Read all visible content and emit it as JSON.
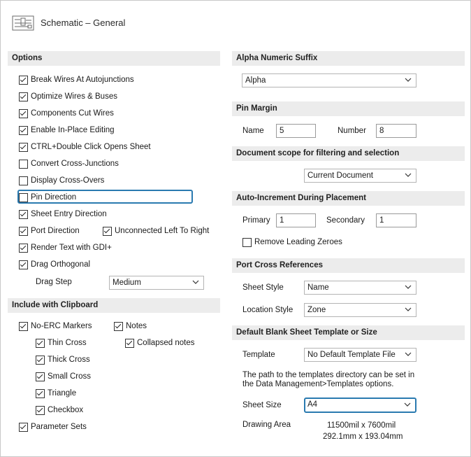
{
  "header": {
    "title": "Schematic – General",
    "icon": "schematic-document-icon"
  },
  "options": {
    "title": "Options",
    "items": [
      {
        "label": "Break Wires At Autojunctions",
        "checked": true
      },
      {
        "label": "Optimize Wires & Buses",
        "checked": true
      },
      {
        "label": "Components Cut Wires",
        "checked": true
      },
      {
        "label": "Enable In-Place Editing",
        "checked": true
      },
      {
        "label": "CTRL+Double Click Opens Sheet",
        "checked": true
      },
      {
        "label": "Convert Cross-Junctions",
        "checked": false
      },
      {
        "label": "Display Cross-Overs",
        "checked": false
      },
      {
        "label": "Pin Direction",
        "checked": false
      },
      {
        "label": "Sheet Entry Direction",
        "checked": true
      },
      {
        "label": "Port Direction",
        "checked": true
      },
      {
        "label": "Unconnected Left To Right",
        "checked": true
      },
      {
        "label": "Render Text with GDI+",
        "checked": true
      },
      {
        "label": "Drag Orthogonal",
        "checked": true
      }
    ],
    "drag_step_label": "Drag Step",
    "drag_step_value": "Medium"
  },
  "clipboard": {
    "title": "Include with Clipboard",
    "no_erc": {
      "label": "No-ERC Markers",
      "checked": true
    },
    "notes": {
      "label": "Notes",
      "checked": true
    },
    "thin_cross": {
      "label": "Thin Cross",
      "checked": true
    },
    "collapsed_notes": {
      "label": "Collapsed notes",
      "checked": true
    },
    "thick_cross": {
      "label": "Thick Cross",
      "checked": true
    },
    "small_cross": {
      "label": "Small Cross",
      "checked": true
    },
    "triangle": {
      "label": "Triangle",
      "checked": true
    },
    "checkbox": {
      "label": "Checkbox",
      "checked": true
    },
    "parameter_sets": {
      "label": "Parameter Sets",
      "checked": true
    }
  },
  "alpha_suffix": {
    "title": "Alpha Numeric Suffix",
    "value": "Alpha"
  },
  "pin_margin": {
    "title": "Pin Margin",
    "name_label": "Name",
    "name_value": "5",
    "number_label": "Number",
    "number_value": "8"
  },
  "doc_scope": {
    "title": "Document scope for filtering and selection",
    "value": "Current Document"
  },
  "auto_increment": {
    "title": "Auto-Increment During Placement",
    "primary_label": "Primary",
    "primary_value": "1",
    "secondary_label": "Secondary",
    "secondary_value": "1",
    "remove_zeroes": {
      "label": "Remove Leading Zeroes",
      "checked": false
    }
  },
  "port_cross": {
    "title": "Port Cross References",
    "sheet_style_label": "Sheet Style",
    "sheet_style_value": "Name",
    "location_style_label": "Location Style",
    "location_style_value": "Zone"
  },
  "template_section": {
    "title": "Default Blank Sheet Template or Size",
    "template_label": "Template",
    "template_value": "No Default Template File",
    "path_note_line1": "The path to the templates directory can be set in",
    "path_note_line2": "the Data Management>Templates options.",
    "sheet_size_label": "Sheet Size",
    "sheet_size_value": "A4",
    "drawing_area_label": "Drawing Area",
    "drawing_area_mil": "11500mil x 7600mil",
    "drawing_area_mm": "292.1mm x 193.04mm"
  }
}
